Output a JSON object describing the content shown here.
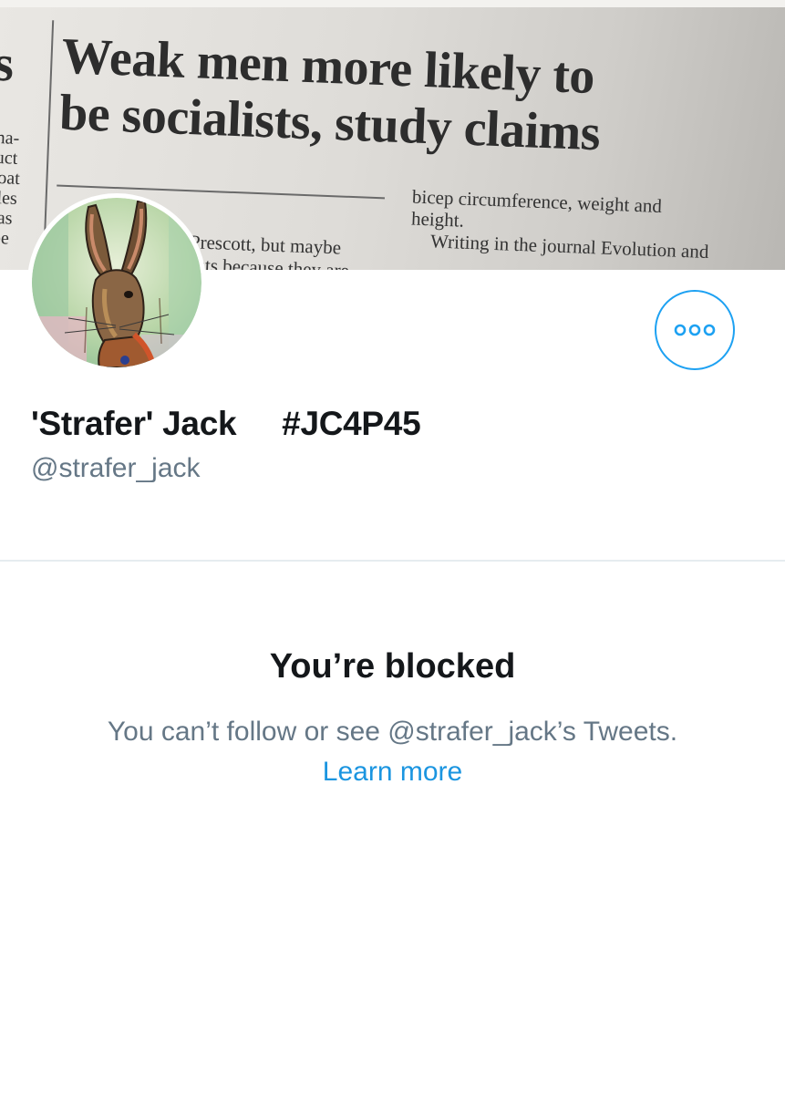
{
  "banner": {
    "headline_line1": "Weak men more likely to",
    "headline_line2": "be socialists, study claims",
    "left_fragment": "s",
    "left_column": "ma-\nluct\ncoat\ncles\nhas\n be",
    "body_left": "Prescott, but maybe",
    "body_left_cut": "ists because they are",
    "body_right_1": "bicep   circumference,   weight   and",
    "body_right_2": "height.",
    "body_right_3": "Writing in the journal Evolution and"
  },
  "profile": {
    "display_name": "'Strafer' Jack     #JC4P45",
    "handle": "@strafer_jack"
  },
  "more_button": {
    "icon": "more-options-icon"
  },
  "blocked": {
    "title": "You’re blocked",
    "message": "You can’t follow or see @strafer_jack’s Tweets.",
    "learn_more": "Learn more"
  },
  "colors": {
    "accent": "#1da1f2",
    "link": "#1b95e0",
    "text_primary": "#14171a",
    "text_secondary": "#657786",
    "divider": "#e6ecf0"
  }
}
